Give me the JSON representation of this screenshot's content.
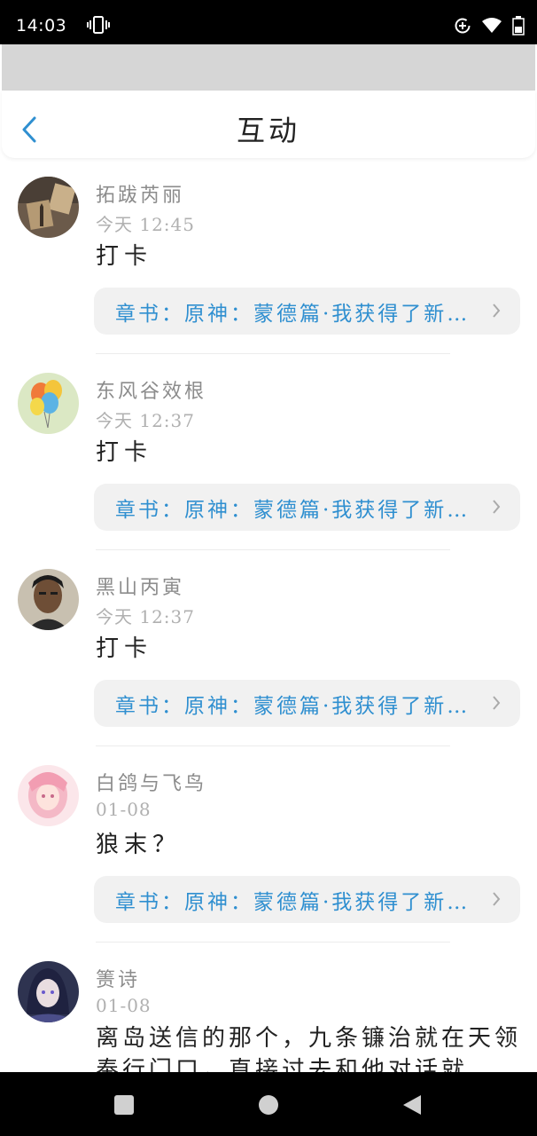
{
  "status_bar": {
    "time": "14:03",
    "icons": [
      "vibrate-icon",
      "data-saver-icon",
      "wifi-icon",
      "battery-icon"
    ]
  },
  "header": {
    "title": "互动",
    "back_icon": "chevron-left-icon"
  },
  "colors": {
    "accent": "#2f8fd0",
    "username": "#8c8c8c",
    "timestamp": "#b0b0b0",
    "link_bg": "#f1f1f1"
  },
  "comments": [
    {
      "username": "拓跋芮丽",
      "time": "今天 12:45",
      "content": "打卡",
      "chapter": "章书：原神：蒙德篇·我获得了新…"
    },
    {
      "username": "东风谷效根",
      "time": "今天 12:37",
      "content": "打卡",
      "chapter": "章书：原神：蒙德篇·我获得了新…"
    },
    {
      "username": "黑山丙寅",
      "time": "今天 12:37",
      "content": "打卡",
      "chapter": "章书：原神：蒙德篇·我获得了新…"
    },
    {
      "username": "白鸽与飞鸟",
      "time": "01-08",
      "content": "狼末？",
      "chapter": "章书：原神：蒙德篇·我获得了新…"
    },
    {
      "username": "箦诗",
      "time": "01-08",
      "content": "离岛送信的那个，九条镰治就在天领奉行门口，直接过去和他对话就"
    }
  ],
  "nav_bar": {
    "buttons": [
      "recent-apps-icon",
      "home-icon",
      "back-triangle-icon"
    ]
  }
}
